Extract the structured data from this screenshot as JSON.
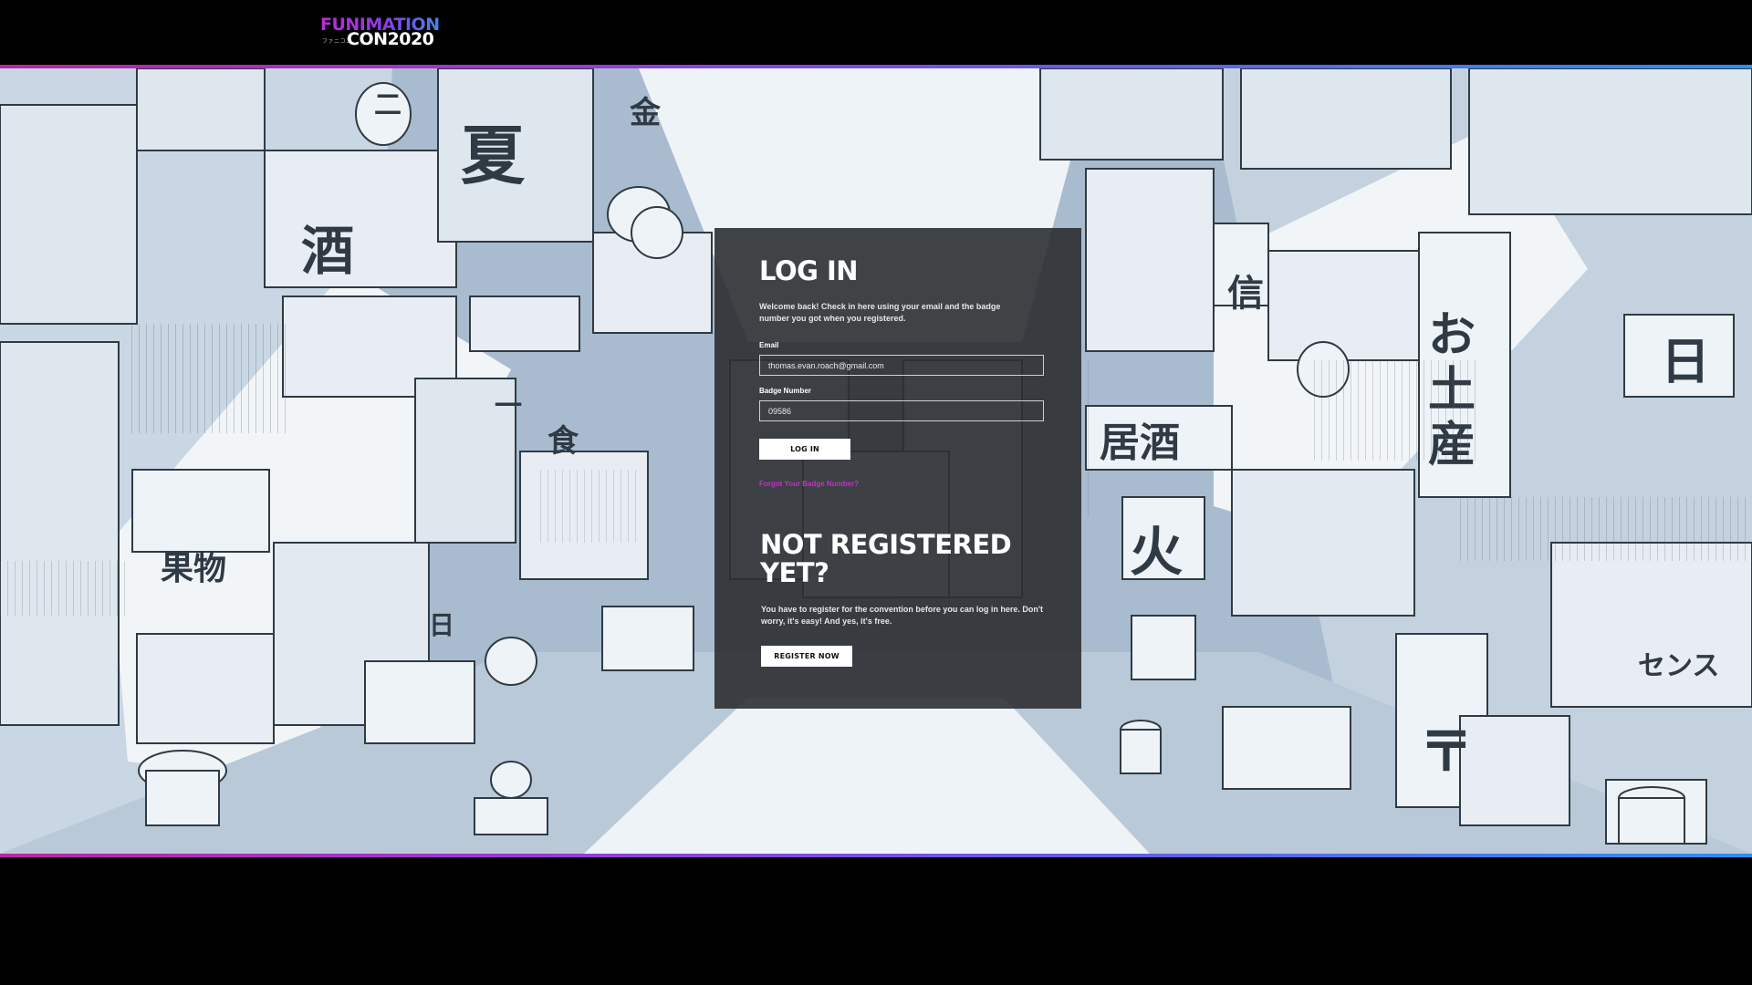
{
  "header": {
    "logo_line1": "FUNIMATION",
    "logo_kana": "ファニコン",
    "logo_line2": "CON2020"
  },
  "login": {
    "title": "LOG IN",
    "intro": "Welcome back! Check in here using your email and the badge number you got when you registered.",
    "email_label": "Email",
    "email_value": "thomas.evan.roach@gmail.com",
    "badge_label": "Badge Number",
    "badge_value": "09586",
    "login_button": "LOG IN",
    "forgot_link": "Forgot Your Badge Number?"
  },
  "register": {
    "title": "NOT REGISTERED YET?",
    "text": "You have to register for the convention before you can log in here. Don't worry, it's easy! And yes, it's free.",
    "register_button": "REGISTER NOW"
  },
  "colors": {
    "accent_pink": "#c52fc9",
    "accent_blue": "#2d8ff0",
    "scene_blue": "#a9bccf",
    "panel": "#28292e"
  }
}
